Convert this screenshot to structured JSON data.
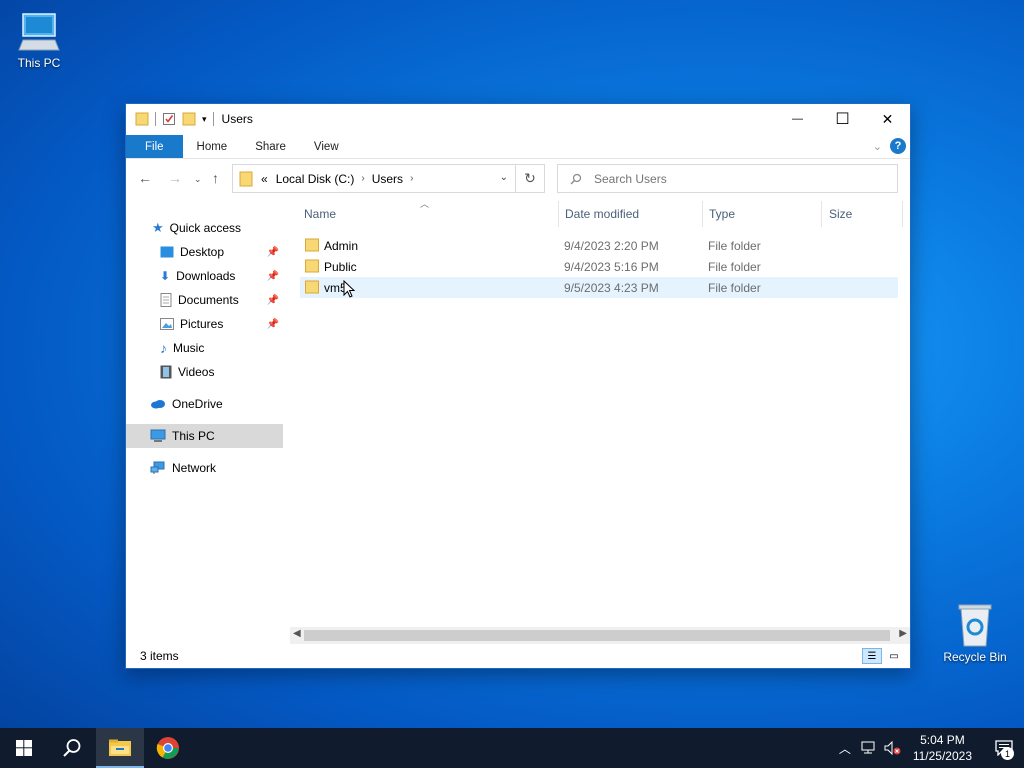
{
  "desktop": {
    "icons": [
      {
        "label": "This PC"
      },
      {
        "label": "Recycle Bin"
      }
    ]
  },
  "window": {
    "title": "Users",
    "controls": {
      "minimize": "—",
      "maximize": "☐",
      "close": "✕"
    },
    "ribbon_tabs": [
      "File",
      "Home",
      "Share",
      "View"
    ],
    "address": {
      "overflow": "«",
      "crumbs": [
        "Local Disk (C:)",
        "Users"
      ]
    },
    "search": {
      "placeholder": "Search Users"
    },
    "nav": {
      "quick_access": "Quick access",
      "items": [
        {
          "label": "Desktop",
          "pinned": true
        },
        {
          "label": "Downloads",
          "pinned": true
        },
        {
          "label": "Documents",
          "pinned": true
        },
        {
          "label": "Pictures",
          "pinned": true
        },
        {
          "label": "Music",
          "pinned": false
        },
        {
          "label": "Videos",
          "pinned": false
        }
      ],
      "onedrive": "OneDrive",
      "this_pc": "This PC",
      "network": "Network"
    },
    "columns": [
      "Name",
      "Date modified",
      "Type",
      "Size"
    ],
    "files": [
      {
        "name": "Admin",
        "date": "9/4/2023 2:20 PM",
        "type": "File folder",
        "size": ""
      },
      {
        "name": "Public",
        "date": "9/4/2023 5:16 PM",
        "type": "File folder",
        "size": ""
      },
      {
        "name": "vm5",
        "date": "9/5/2023 4:23 PM",
        "type": "File folder",
        "size": "",
        "hovered": true
      }
    ],
    "status": "3 items"
  },
  "taskbar": {
    "clock_time": "5:04 PM",
    "clock_date": "11/25/2023",
    "notification_count": "1"
  },
  "colors": {
    "accent": "#1979ca",
    "folder": "#f8d775",
    "taskbar": "#101b2e"
  }
}
